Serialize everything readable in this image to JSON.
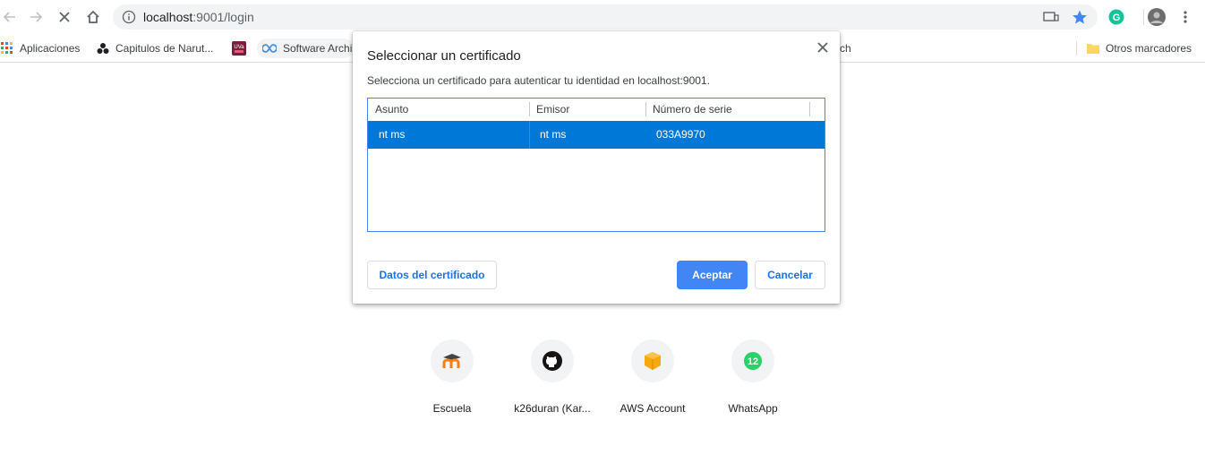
{
  "browser": {
    "url_host": "localhost",
    "url_rest": ":9001/login",
    "icons": [
      "back-arrow-icon",
      "forward-arrow-icon",
      "stop-icon",
      "home-icon",
      "info-icon",
      "cast-icon",
      "star-icon",
      "grammarly-icon",
      "avatar",
      "more-menu-icon"
    ]
  },
  "bookmarks": {
    "items": [
      {
        "label": "Aplicaciones",
        "icon": "apps-grid-icon"
      },
      {
        "label": "Capitulos de Narut...",
        "icon": "naruto-icon"
      },
      {
        "label": "",
        "icon": "uva-icon"
      },
      {
        "label": "Software Archi",
        "icon": "infinity-icon"
      },
      {
        "label": "ch",
        "icon": ""
      }
    ],
    "other": "Otros marcadores"
  },
  "dialog": {
    "title": "Seleccionar un certificado",
    "description": "Selecciona un certificado para autenticar tu identidad en localhost:9001.",
    "columns": [
      "Asunto",
      "Emisor",
      "Número de serie"
    ],
    "rows": [
      {
        "subject": "nt ms",
        "issuer": "nt ms",
        "serial": "033A9970",
        "selected": true
      }
    ],
    "cert_data_button": "Datos del certificado",
    "accept_button": "Aceptar",
    "cancel_button": "Cancelar"
  },
  "shortcuts": [
    {
      "label": "Escuela",
      "icon": "moodle-icon"
    },
    {
      "label": "k26duran (Kar...",
      "icon": "github-icon"
    },
    {
      "label": "AWS Account",
      "icon": "aws-box-icon"
    },
    {
      "label": "WhatsApp",
      "icon": "whatsapp-icon"
    }
  ],
  "colors": {
    "selection": "#0078d7",
    "accent": "#4285f4",
    "link": "#1a73e8"
  }
}
